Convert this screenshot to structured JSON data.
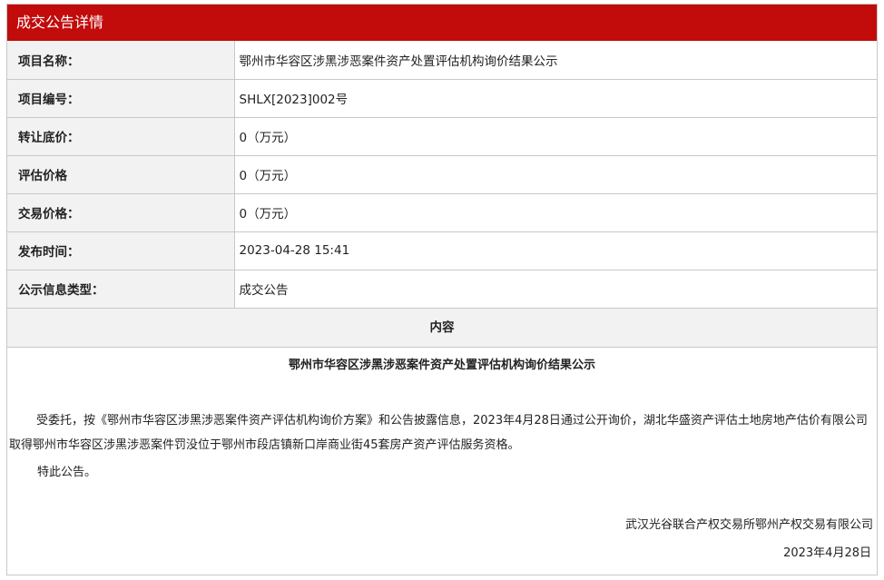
{
  "header": {
    "title": "成交公告详情"
  },
  "fields": [
    {
      "label": "项目名称：",
      "value": "鄂州市华容区涉黑涉恶案件资产处置评估机构询价结果公示"
    },
    {
      "label": "项目编号：",
      "value": "SHLX[2023]002号"
    },
    {
      "label": "转让底价：",
      "value": "0（万元）"
    },
    {
      "label": "评估价格",
      "value": "0（万元）"
    },
    {
      "label": "交易价格：",
      "value": "0（万元）"
    },
    {
      "label": "发布时间：",
      "value": "2023-04-28 15:41"
    },
    {
      "label": "公示信息类型：",
      "value": "成交公告"
    }
  ],
  "content": {
    "header": "内容",
    "title": "鄂州市华容区涉黑涉恶案件资产处置评估机构询价结果公示",
    "body": "受委托，按《鄂州市华容区涉黑涉恶案件资产评估机构询价方案》和公告披露信息，2023年4月28日通过公开询价，湖北华盛资产评估土地房地产估价有限公司取得鄂州市华容区涉黑涉恶案件罚没位于鄂州市段店镇新口岸商业街45套房产资产评估服务资格。",
    "closing": "特此公告。",
    "signature": "武汉光谷联合产权交易所鄂州产权交易有限公司",
    "date": "2023年4月28日"
  }
}
